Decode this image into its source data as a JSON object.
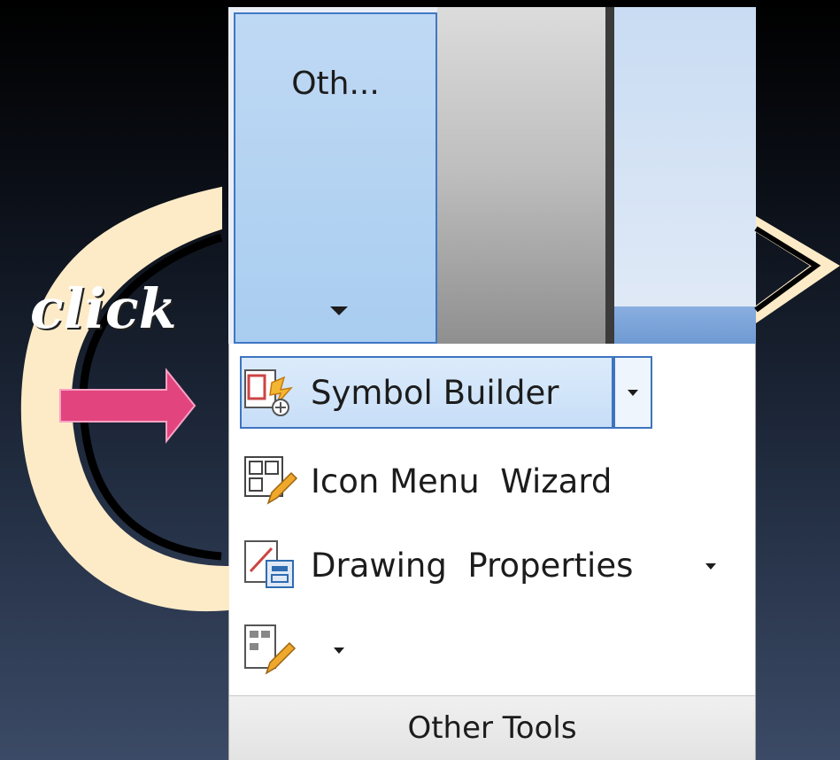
{
  "ribbon": {
    "group_button_label": "Oth..."
  },
  "menu": {
    "items": [
      {
        "label": "Symbol Builder",
        "has_dropdown": true
      },
      {
        "label": "Icon Menu  Wizard",
        "has_dropdown": false
      },
      {
        "label": "Drawing  Properties",
        "has_dropdown": true
      },
      {
        "label": "",
        "has_dropdown": true
      }
    ],
    "group_label": "Other Tools"
  },
  "annotation": {
    "click_text": "click"
  },
  "icons": [
    "symbol-builder-icon",
    "icon-menu-wizard-icon",
    "drawing-properties-icon",
    "edit-tool-icon"
  ],
  "colors": {
    "accent_border": "#3d74bf",
    "ribbon_button": "#a9cdf0",
    "arrow_fill": "#fdebc8",
    "click_arrow": "#e2457e"
  }
}
